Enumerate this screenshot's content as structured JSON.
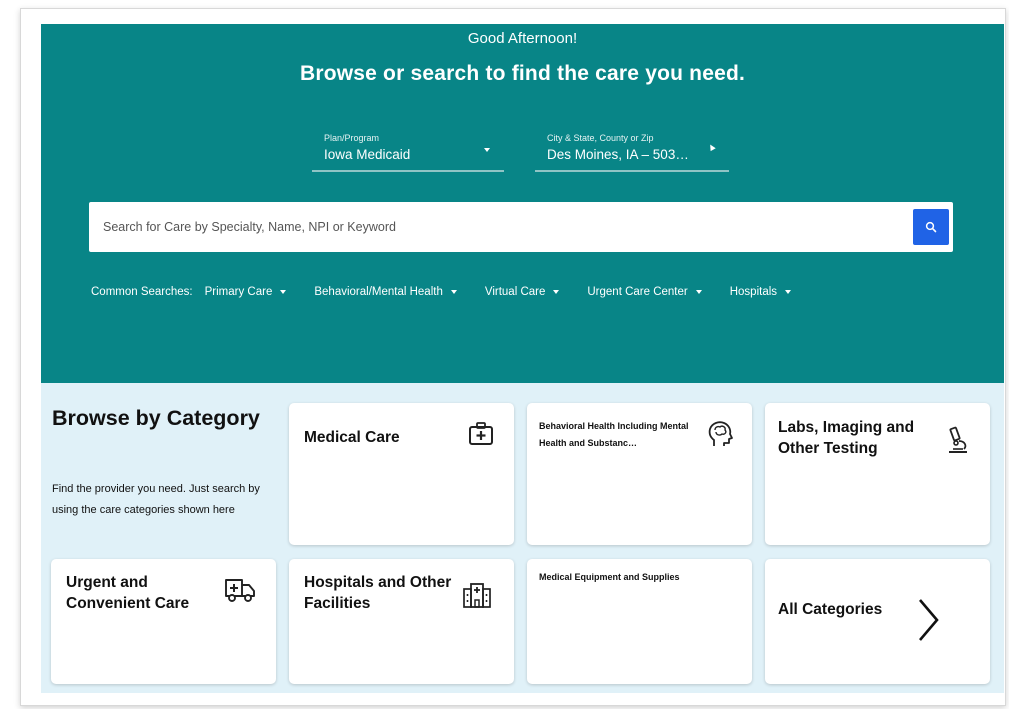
{
  "hero": {
    "greeting": "Good Afternoon!",
    "headline": "Browse or search to find the care you need.",
    "plan": {
      "label": "Plan/Program",
      "value": "Iowa Medicaid"
    },
    "location": {
      "label": "City & State, County or Zip",
      "value": "Des Moines, IA – 503…"
    },
    "search": {
      "placeholder": "Search for Care by Specialty, Name, NPI or Keyword"
    },
    "common_searches": {
      "label": "Common Searches:",
      "items": [
        "Primary Care",
        "Behavioral/Mental Health",
        "Virtual Care",
        "Urgent Care Center",
        "Hospitals"
      ]
    }
  },
  "browse": {
    "title": "Browse by Category",
    "description": "Find the provider you need. Just search by using the care categories shown here"
  },
  "categories": [
    {
      "title": "Medical Care",
      "icon": "medical-kit-icon"
    },
    {
      "title": "Behavioral Health Including Mental Health and Substanc…",
      "icon": "head-brain-icon"
    },
    {
      "title": "Labs, Imaging and Other Testing",
      "icon": "microscope-icon"
    },
    {
      "title": "Urgent and Convenient Care",
      "icon": "ambulance-icon"
    },
    {
      "title": "Hospitals and Other Facilities",
      "icon": "hospital-building-icon"
    },
    {
      "title": "Medical Equipment and Supplies",
      "icon": ""
    },
    {
      "title": "All Categories",
      "icon": "chevron-right-icon"
    }
  ],
  "colors": {
    "hero_bg": "#088587",
    "panel_bg": "#e0f1f8",
    "search_button": "#2063e6"
  }
}
